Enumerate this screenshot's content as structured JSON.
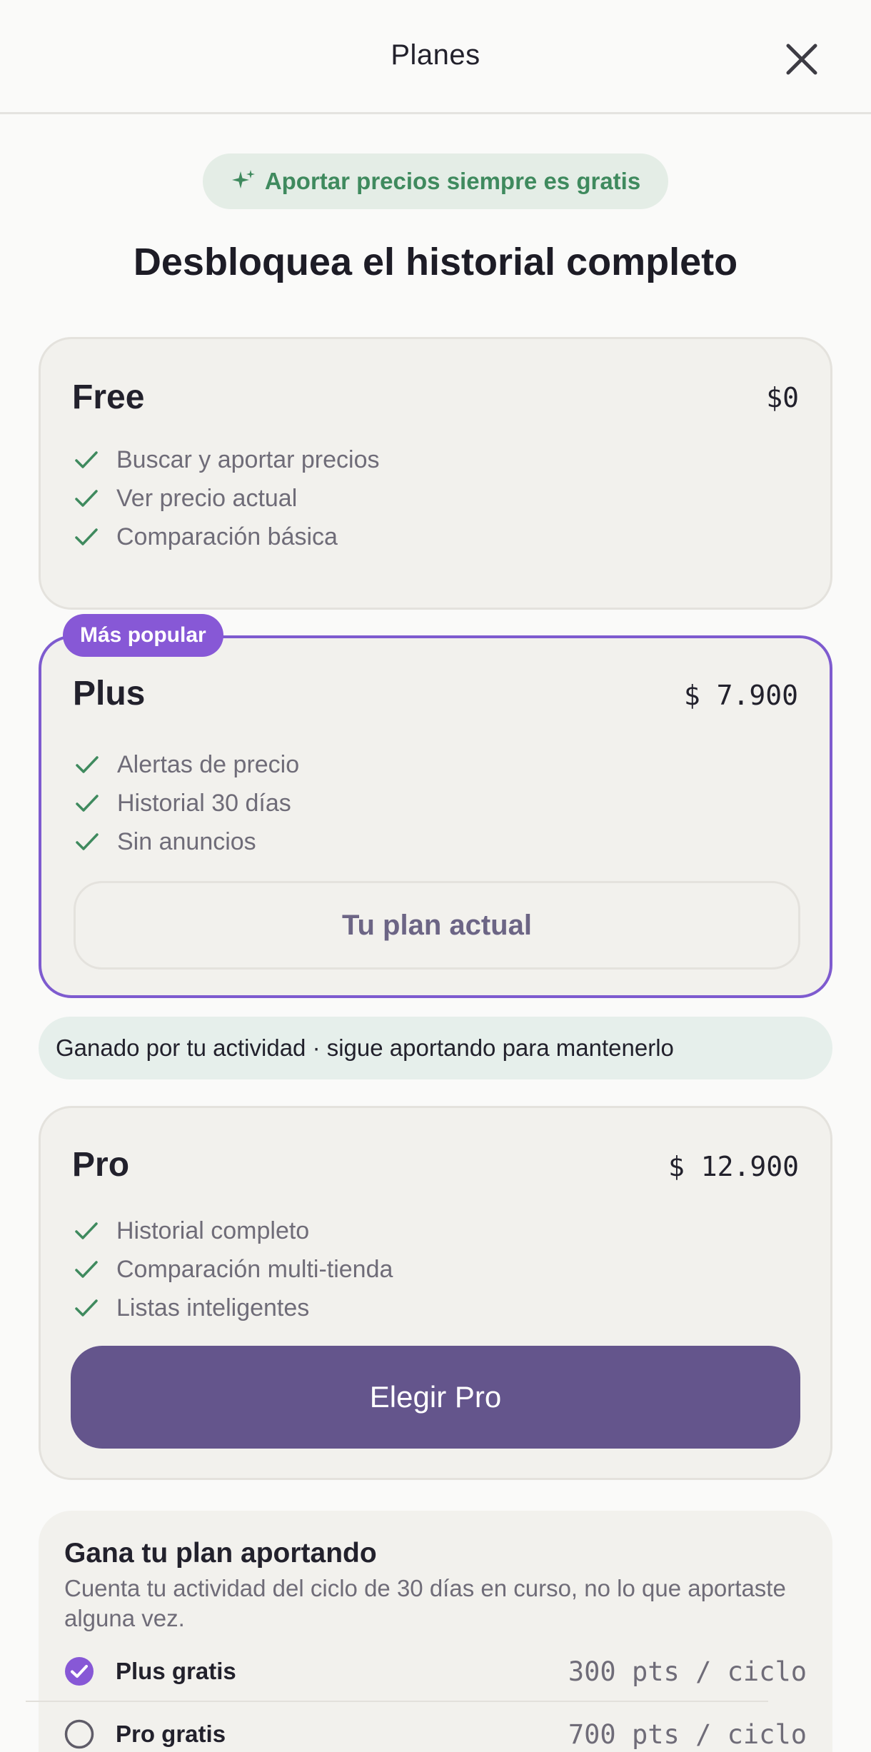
{
  "header": {
    "title": "Planes"
  },
  "banner": {
    "text": "Aportar precios siempre es gratis",
    "icon": "sparkle-icon"
  },
  "headline": "Desbloquea el historial completo",
  "colors": {
    "accent": "#7e5bcf",
    "success": "#3f8a5e",
    "primary_button": "#64558c"
  },
  "plans": [
    {
      "name": "Free",
      "price": "$0",
      "features": [
        "Buscar y aportar precios",
        "Ver precio actual",
        "Comparación básica"
      ]
    },
    {
      "name": "Plus",
      "price": "$ 7.900",
      "badge": "Más popular",
      "features": [
        "Alertas de precio",
        "Historial 30 días",
        "Sin anuncios"
      ],
      "button": "Tu plan actual",
      "note": "Ganado por tu actividad · sigue aportando para mantenerlo"
    },
    {
      "name": "Pro",
      "price": "$ 12.900",
      "features": [
        "Historial completo",
        "Comparación multi-tienda",
        "Listas inteligentes"
      ],
      "button": "Elegir Pro"
    }
  ],
  "earn": {
    "title": "Gana tu plan aportando",
    "description": "Cuenta tu actividad del ciclo de 30 días en curso, no lo que aportaste alguna vez.",
    "tiers": [
      {
        "name": "Plus gratis",
        "points": "300 pts / ciclo",
        "achieved": true
      },
      {
        "name": "Pro gratis",
        "points": "700 pts / ciclo",
        "achieved": false
      }
    ]
  }
}
